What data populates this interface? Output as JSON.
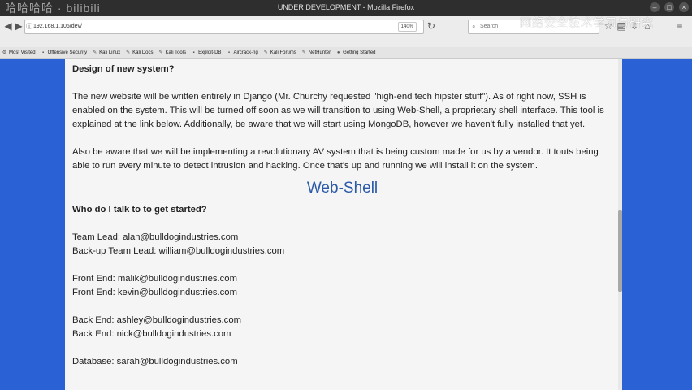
{
  "window": {
    "title": "UNDER DEVELOPMENT - Mozilla Firefox",
    "watermark_left": "哈哈哈哈 · bilibili",
    "watermark_right": "网络安全技术学习与研究",
    "controls": [
      "–",
      "□",
      "×"
    ]
  },
  "navbar": {
    "url": "192.168.1.106/dev/",
    "zoom": "140%",
    "search_placeholder": "Search",
    "icons": [
      "back-icon",
      "forward-icon",
      "info-icon",
      "reload-icon",
      "star-icon",
      "reader-icon",
      "download-icon",
      "home-icon",
      "menu-icon"
    ]
  },
  "bookmarks": [
    {
      "label": "Most Visited"
    },
    {
      "label": "Offensive Security"
    },
    {
      "label": "Kali Linux"
    },
    {
      "label": "Kali Docs"
    },
    {
      "label": "Kali Tools"
    },
    {
      "label": "Exploit-DB"
    },
    {
      "label": "Aircrack-ng"
    },
    {
      "label": "Kali Forums"
    },
    {
      "label": "NetHunter"
    },
    {
      "label": "Getting Started"
    }
  ],
  "page": {
    "heading": "Design of new system?",
    "para1": "The new website will be written entirely in Django (Mr. Churchy requested \"high-end tech hipster stuff\"). As of right now, SSH is enabled on the system. This will be turned off soon as we will transition to using Web-Shell, a proprietary shell interface. This tool is explained at the link below. Additionally, be aware that we will start using MongoDB, however we haven't fully installed that yet.",
    "para2": "Also be aware that we will be implementing a revolutionary AV system that is being custom made for us by a vendor. It touts being able to run every minute to detect intrusion and hacking. Once that's up and running we will install it on the system.",
    "webshell_link": "Web-Shell",
    "who_heading": "Who do I talk to to get started?",
    "contacts": [
      [
        "Team Lead: alan@bulldogindustries.com",
        "Back-up Team Lead: william@bulldogindustries.com"
      ],
      [
        "Front End: malik@bulldogindustries.com",
        "Front End: kevin@bulldogindustries.com"
      ],
      [
        "Back End: ashley@bulldogindustries.com",
        "Back End: nick@bulldogindustries.com"
      ],
      [
        "Database: sarah@bulldogindustries.com"
      ]
    ]
  },
  "colors": {
    "background_blue": "#2a62d6",
    "link_blue": "#2a5aa8",
    "page_bg": "#f5f5f5"
  }
}
